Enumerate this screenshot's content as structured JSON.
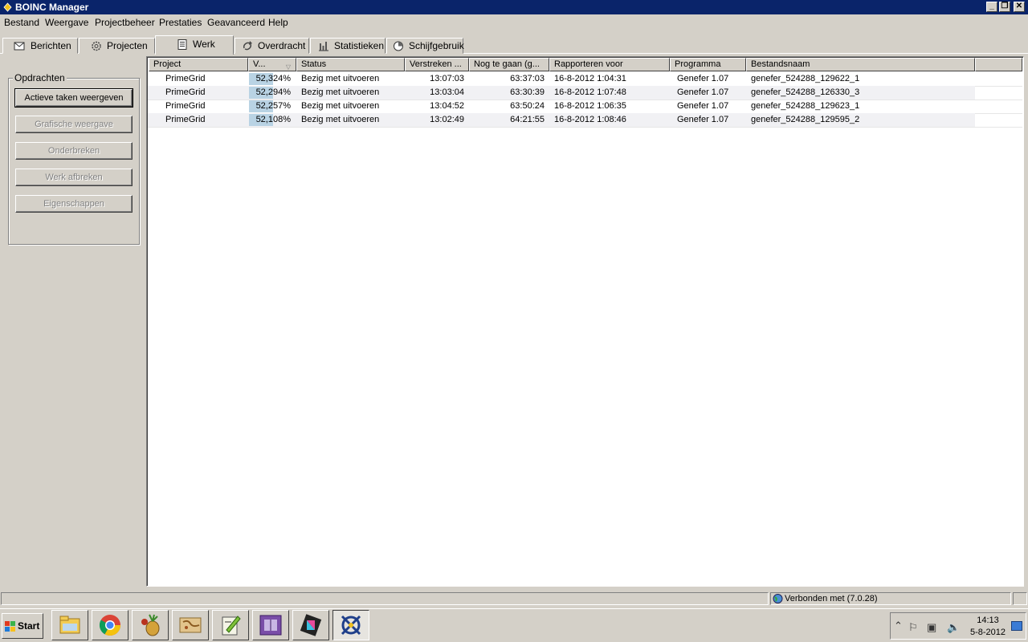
{
  "window": {
    "title": "BOINC Manager"
  },
  "menu": [
    "Bestand",
    "Weergave",
    "Projectbeheer",
    "Prestaties",
    "Geavanceerd",
    "Help"
  ],
  "tabs": [
    {
      "label": "Berichten",
      "icon": "envelope-icon"
    },
    {
      "label": "Projecten",
      "icon": "gear-icon"
    },
    {
      "label": "Werk",
      "icon": "document-icon",
      "active": true
    },
    {
      "label": "Overdracht",
      "icon": "transfer-icon"
    },
    {
      "label": "Statistieken",
      "icon": "bar-chart-icon"
    },
    {
      "label": "Schijfgebruik",
      "icon": "disk-pie-icon"
    }
  ],
  "sidebar": {
    "group_title": "Opdrachten",
    "buttons": [
      {
        "label": "Actieve taken weergeven",
        "enabled": true
      },
      {
        "label": "Grafische weergave",
        "enabled": false
      },
      {
        "label": "Onderbreken",
        "enabled": false
      },
      {
        "label": "Werk afbreken",
        "enabled": false
      },
      {
        "label": "Eigenschappen",
        "enabled": false
      }
    ]
  },
  "table": {
    "columns": [
      "Project",
      "V...",
      "Status",
      "Verstreken ...",
      "Nog te gaan (g...",
      "Rapporteren voor",
      "Programma",
      "Bestandsnaam"
    ],
    "rows": [
      {
        "project": "PrimeGrid",
        "progress": "52,324%",
        "progress_value": 52.324,
        "status": "Bezig met uitvoeren",
        "elapsed": "13:07:03",
        "remaining": "63:37:03",
        "deadline": "16-8-2012 1:04:31",
        "application": "Genefer 1.07",
        "name": "genefer_524288_129622_1"
      },
      {
        "project": "PrimeGrid",
        "progress": "52,294%",
        "progress_value": 52.294,
        "status": "Bezig met uitvoeren",
        "elapsed": "13:03:04",
        "remaining": "63:30:39",
        "deadline": "16-8-2012 1:07:48",
        "application": "Genefer 1.07",
        "name": "genefer_524288_126330_3"
      },
      {
        "project": "PrimeGrid",
        "progress": "52,257%",
        "progress_value": 52.257,
        "status": "Bezig met uitvoeren",
        "elapsed": "13:04:52",
        "remaining": "63:50:24",
        "deadline": "16-8-2012 1:06:35",
        "application": "Genefer 1.07",
        "name": "genefer_524288_129623_1"
      },
      {
        "project": "PrimeGrid",
        "progress": "52,108%",
        "progress_value": 52.108,
        "status": "Bezig met uitvoeren",
        "elapsed": "13:02:49",
        "remaining": "64:21:55",
        "deadline": "16-8-2012 1:08:46",
        "application": "Genefer 1.07",
        "name": "genefer_524288_129595_2"
      }
    ]
  },
  "statusbar": {
    "connection": "Verbonden met  (7.0.28)"
  },
  "taskbar": {
    "start_label": "Start",
    "apps": [
      "explorer-icon",
      "chrome-icon",
      "fruit-app-icon",
      "map-app-icon",
      "notepad-plus-icon",
      "cpu-z-icon",
      "color-app-icon",
      "boinc-icon"
    ],
    "time": "14:13",
    "date": "5-8-2012"
  },
  "colors": {
    "titlebar": "#0a246a",
    "progress": "#b9d3e4",
    "row_alt": "#f1f1f4"
  }
}
